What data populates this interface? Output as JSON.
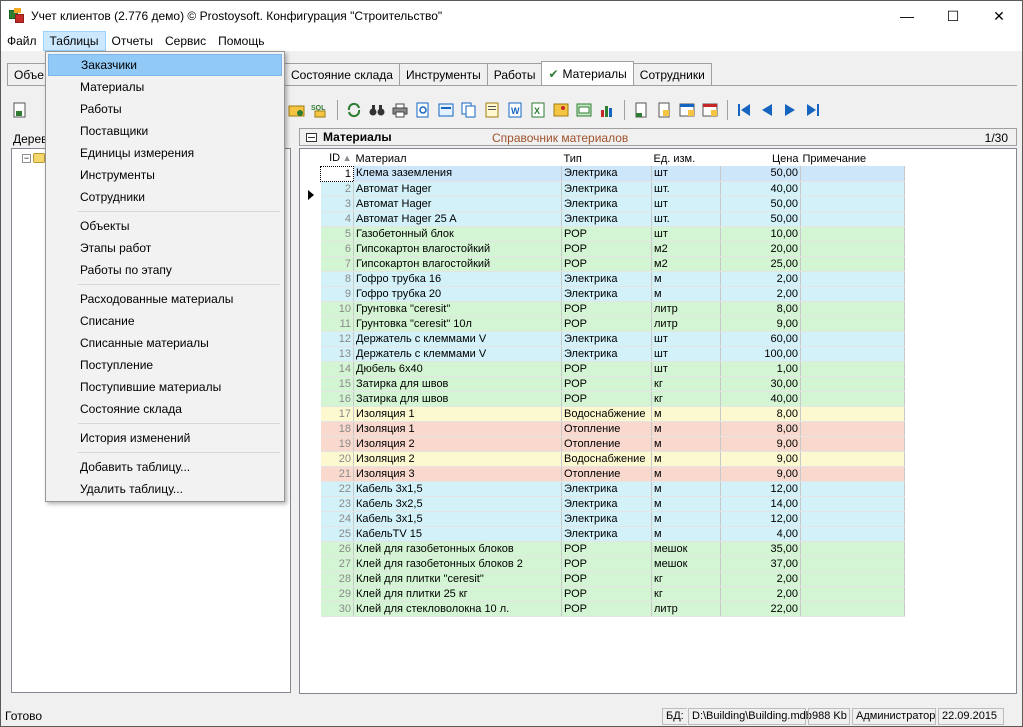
{
  "window": {
    "title": "Учет клиентов (2.776 демо) © Prostoysoft. Конфигурация \"Строительство\"",
    "minimize": "—",
    "maximize": "☐",
    "close": "✕"
  },
  "menu": [
    "Файл",
    "Таблицы",
    "Отчеты",
    "Сервис",
    "Помощь"
  ],
  "tabs": [
    {
      "label": "Объе",
      "selected": false
    },
    {
      "label": "Состояние склада",
      "selected": false
    },
    {
      "label": "Инструменты",
      "selected": false
    },
    {
      "label": "Работы",
      "selected": false
    },
    {
      "label": "Материалы",
      "selected": true,
      "check": "✔"
    },
    {
      "label": "Сотрудники",
      "selected": false
    }
  ],
  "left": {
    "label": "Дерев"
  },
  "panel": {
    "title": "Материалы",
    "subtitle": "Справочник материалов",
    "count": "1/30"
  },
  "columns": {
    "id": "ID",
    "material": "Материал",
    "type": "Тип",
    "unit": "Ед. изм.",
    "price": "Цена",
    "note": "Примечание"
  },
  "rows": [
    {
      "id": "1",
      "material": "Клема заземления",
      "type": "Электрика",
      "unit": "шт",
      "price": "50,00",
      "cat": "sel"
    },
    {
      "id": "2",
      "material": "Автомат Hager",
      "type": "Электрика",
      "unit": "шт.",
      "price": "40,00",
      "cat": "el"
    },
    {
      "id": "3",
      "material": "Автомат Hager",
      "type": "Электрика",
      "unit": "шт",
      "price": "50,00",
      "cat": "el"
    },
    {
      "id": "4",
      "material": "Автомат Hager 25 A",
      "type": "Электрика",
      "unit": "шт.",
      "price": "50,00",
      "cat": "el"
    },
    {
      "id": "5",
      "material": "Газобетонный блок",
      "type": "РОР",
      "unit": "шт",
      "price": "10,00",
      "cat": "por"
    },
    {
      "id": "6",
      "material": "Гипсокартон влагостойкий",
      "type": "РОР",
      "unit": "м2",
      "price": "20,00",
      "cat": "por"
    },
    {
      "id": "7",
      "material": "Гипсокартон влагостойкий",
      "type": "РОР",
      "unit": "м2",
      "price": "25,00",
      "cat": "por"
    },
    {
      "id": "8",
      "material": "Гофро трубка 16",
      "type": "Электрика",
      "unit": "м",
      "price": "2,00",
      "cat": "el"
    },
    {
      "id": "9",
      "material": "Гофро трубка 20",
      "type": "Электрика",
      "unit": "м",
      "price": "2,00",
      "cat": "el"
    },
    {
      "id": "10",
      "material": "Грунтовка \"ceresit\"",
      "type": "РОР",
      "unit": "литр",
      "price": "8,00",
      "cat": "por"
    },
    {
      "id": "11",
      "material": "Грунтовка \"ceresit\"  10л",
      "type": "РОР",
      "unit": "литр",
      "price": "9,00",
      "cat": "por"
    },
    {
      "id": "12",
      "material": "Держатель с клеммами V",
      "type": "Электрика",
      "unit": "шт",
      "price": "60,00",
      "cat": "el"
    },
    {
      "id": "13",
      "material": "Держатель с клеммами V",
      "type": "Электрика",
      "unit": "шт",
      "price": "100,00",
      "cat": "el"
    },
    {
      "id": "14",
      "material": "Дюбель 6х40",
      "type": "РОР",
      "unit": "шт",
      "price": "1,00",
      "cat": "por"
    },
    {
      "id": "15",
      "material": "Затирка для швов",
      "type": "РОР",
      "unit": "кг",
      "price": "30,00",
      "cat": "por"
    },
    {
      "id": "16",
      "material": "Затирка для швов",
      "type": "РОР",
      "unit": "кг",
      "price": "40,00",
      "cat": "por"
    },
    {
      "id": "17",
      "material": "Изоляция 1",
      "type": "Водоснабжение",
      "unit": "м",
      "price": "8,00",
      "cat": "vod"
    },
    {
      "id": "18",
      "material": "Изоляция 1",
      "type": "Отопление",
      "unit": "м",
      "price": "8,00",
      "cat": "ot"
    },
    {
      "id": "19",
      "material": "Изоляция 2",
      "type": "Отопление",
      "unit": "м",
      "price": "9,00",
      "cat": "ot"
    },
    {
      "id": "20",
      "material": "Изоляция 2",
      "type": "Водоснабжение",
      "unit": "м",
      "price": "9,00",
      "cat": "vod"
    },
    {
      "id": "21",
      "material": "Изоляция 3",
      "type": "Отопление",
      "unit": "м",
      "price": "9,00",
      "cat": "ot"
    },
    {
      "id": "22",
      "material": "Кабель 3х1,5",
      "type": "Электрика",
      "unit": "м",
      "price": "12,00",
      "cat": "el"
    },
    {
      "id": "23",
      "material": "Кабель 3х2,5",
      "type": "Электрика",
      "unit": "м",
      "price": "14,00",
      "cat": "el"
    },
    {
      "id": "24",
      "material": "Кабель 3х1,5",
      "type": "Электрика",
      "unit": "м",
      "price": "12,00",
      "cat": "el"
    },
    {
      "id": "25",
      "material": "КабельTV  15",
      "type": "Электрика",
      "unit": "м",
      "price": "4,00",
      "cat": "el"
    },
    {
      "id": "26",
      "material": "Клей для газобетонных блоков",
      "type": "РОР",
      "unit": "мешок",
      "price": "35,00",
      "cat": "por"
    },
    {
      "id": "27",
      "material": "Клей для газобетонных блоков 2",
      "type": "РОР",
      "unit": "мешок",
      "price": "37,00",
      "cat": "por"
    },
    {
      "id": "28",
      "material": "Клей для плитки \"ceresit\"",
      "type": "РОР",
      "unit": "кг",
      "price": "2,00",
      "cat": "por"
    },
    {
      "id": "29",
      "material": "Клей для плитки  25 кг",
      "type": "РОР",
      "unit": "кг",
      "price": "2,00",
      "cat": "por"
    },
    {
      "id": "30",
      "material": "Клей для стекловолокна 10 л.",
      "type": "РОР",
      "unit": "литр",
      "price": "22,00",
      "cat": "por"
    }
  ],
  "dropdown": [
    {
      "label": "Заказчики",
      "hl": true
    },
    {
      "label": "Материалы"
    },
    {
      "label": "Работы"
    },
    {
      "label": "Поставщики"
    },
    {
      "label": "Единицы измерения"
    },
    {
      "label": "Инструменты"
    },
    {
      "label": "Сотрудники",
      "sep": true
    },
    {
      "label": "Объекты"
    },
    {
      "label": "Этапы работ"
    },
    {
      "label": "Работы по этапу",
      "sep": true
    },
    {
      "label": "Расходованные материалы"
    },
    {
      "label": "Списание"
    },
    {
      "label": "Списанные материалы"
    },
    {
      "label": "Поступление"
    },
    {
      "label": "Поступившие материалы"
    },
    {
      "label": "Состояние склада",
      "sep": true
    },
    {
      "label": "История изменений",
      "sep": true
    },
    {
      "label": "Добавить таблицу..."
    },
    {
      "label": "Удалить таблицу..."
    }
  ],
  "status": {
    "ready": "Готово",
    "db_label": "БД:",
    "db_path": "D:\\Building\\Building.mdb",
    "size": "988 Kb",
    "user": "Администратор",
    "date": "22.09.2015"
  },
  "toolbar_icons": [
    "new-record-icon",
    "yellow-folder-icon",
    "sql-icon",
    "refresh-icon",
    "binoculars-icon",
    "print-icon",
    "preview-icon",
    "export-icon",
    "copy-icon",
    "doc-icon",
    "word-icon",
    "excel-icon",
    "image-icon",
    "html-icon",
    "chart-icon",
    "filter-icon",
    "edit-icon",
    "grid-icon",
    "report-icon",
    "first-record-icon",
    "prev-record-icon",
    "next-record-icon",
    "last-record-icon"
  ],
  "colors": {
    "electrics": "#d2f1f8",
    "por": "#d4f5d3",
    "water": "#fcf9d0",
    "heating": "#f9d9ce",
    "selected": "#cde6fa",
    "menu_highlight": "#91c9f7"
  }
}
